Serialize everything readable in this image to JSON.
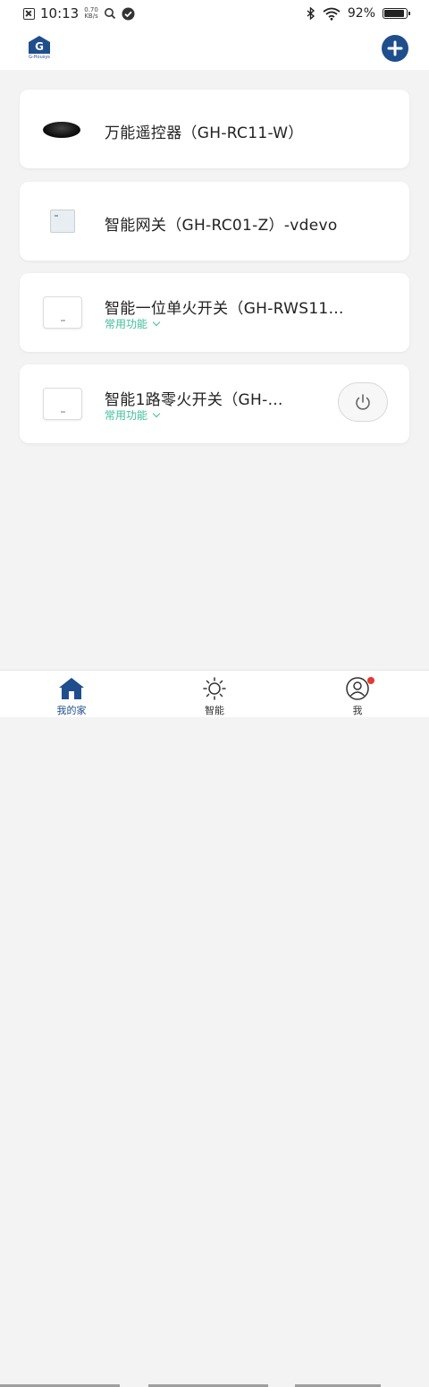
{
  "status_bar": {
    "time": "10:13",
    "speed_value": "0.70",
    "speed_unit": "KB/s",
    "battery": "92%",
    "battery_level": 0.92
  },
  "header": {
    "logo_letter": "G",
    "logo_brand": "G-Housys",
    "add_icon": "plus-icon"
  },
  "devices": [
    {
      "name": "万能遥控器（GH-RC11-W）",
      "icon": "ir-remote",
      "sub": ""
    },
    {
      "name": "智能网关（GH-RC01-Z）-vdevo",
      "icon": "gateway",
      "sub": ""
    },
    {
      "name": "智能一位单火开关（GH-RWS11…",
      "icon": "wall-switch",
      "sub": "常用功能"
    },
    {
      "name": "智能1路零火开关（GH-…",
      "icon": "wall-switch",
      "sub": "常用功能",
      "has_power_button": true
    }
  ],
  "nav": {
    "items": [
      {
        "label": "我的家",
        "icon": "home-icon",
        "active": true
      },
      {
        "label": "智能",
        "icon": "sun-icon",
        "active": false
      },
      {
        "label": "我",
        "icon": "user-icon",
        "active": false,
        "badge": true
      }
    ]
  },
  "colors": {
    "brand": "#1e4e8c",
    "accent_green": "#3fbf9a",
    "badge_red": "#e53935",
    "background": "#f3f3f3"
  }
}
